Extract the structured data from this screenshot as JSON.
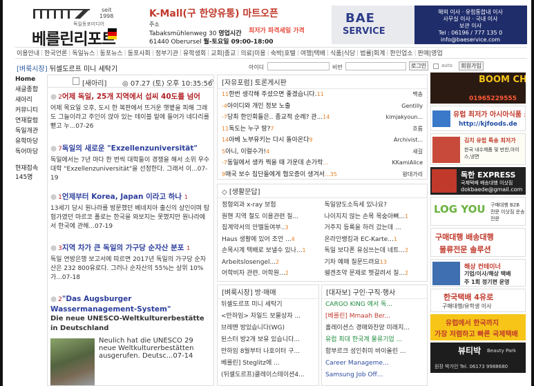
{
  "header": {
    "logo_name": "베를린리포트",
    "logo_seit": "seit",
    "logo_year": "1998",
    "logo_sub": "독일동포미디어"
  },
  "kmall": {
    "title": "K-Mall(구 한양유통) 마트오픈",
    "addr_label": "주소",
    "street": "Tabaksmühlenweg 30",
    "hours_label": "영업시간",
    "city": "61440    Oberursel",
    "hours": "월-토요일 09:00-18:00",
    "promo": "최저가 파격세일 가격"
  },
  "bae": {
    "brand1": "BAE",
    "brand2": "SERVICE",
    "line1": "해외 이사 · 유럽통합내 이사",
    "line2": "사무실 이사 · 국내 이사",
    "line3": "보관 이사",
    "line4": "Tel : 06196 / 777 135 0",
    "line5": "info@baeservice.com"
  },
  "nav": [
    "이용안내",
    "한국언론",
    "독일뉴스",
    "동포뉴스",
    "동포사회",
    "정부기관",
    "유학생회",
    "교회|종교",
    "의료|미용",
    "숙박|호텔",
    "여행|택배",
    "식품|식당",
    "법률|회계",
    "한인업소",
    "판매|영업"
  ],
  "crumb": {
    "section": "[벼룩시장]",
    "title": "뒤셀도르프 미니 세탁기"
  },
  "login": {
    "id_label": "아이디",
    "pw_label": "비번",
    "login_btn": "로그인",
    "auto_label": "auto",
    "join_btn": "회원가입"
  },
  "sidebar": {
    "items": [
      "Home",
      "새글종합",
      "새아리",
      "커뮤니티",
      "연재칼럼",
      "독일개관",
      "유학마당",
      "독어마당"
    ],
    "visit_label": "현재접속",
    "visit_count": "145명"
  },
  "news": {
    "category": "[새아리]",
    "time": "07.27 (토) 오후 10:35:56",
    "pager": "ㅇ",
    "articles": [
      {
        "num": "2",
        "title": "어제 독일, 25개 지역에서 섭씨 40도를 넘어",
        "cnt": "",
        "body": "어제 목요일 오후, 도시 한 복판에서 뜨거운 햇볕을 피해 그래도 그늘이라고 주인이 앉아 있는 테이블 밑에 들어가 네다리를 뻗고 누...07-26"
      },
      {
        "num": "7",
        "title": "독일의 새로운 \"Exzellenzuniversität\"",
        "cnt": "",
        "body": "독일에서는 7년 마다 한 번씩 대학들이 경쟁을 해서 소위 우수대학 \"Exzellenzuniversität\"을 선정한다. 그래서 이...07-19"
      },
      {
        "num": "1",
        "title": "언제부터 Korea, Japan 이라고 하나",
        "cnt": "1",
        "body": "13세기 당시 원나라를 방문했던 베네치아 출신의 상인이며 탐험가였던 마르코 폴로는 한국을 와보지는 못했지만 원나라에서 한국에 관해...07-19"
      },
      {
        "num": "3",
        "title": "지역 차가 큰 독일의 가구당 순자산 분포",
        "cnt": "1",
        "body": "독일 연방은행 보고서에 따르면 2017년 독일의 가구당 순자산은 232 800유로다. 그러나 순자산의 55%는 상위 10%가...07-18"
      },
      {
        "num": "2",
        "title": "\"Das Augsburger Wassermanagement-System\"",
        "cnt": "",
        "sub": "Die neue UNESCO-Weltkulturerbestätte in Deutschland",
        "body": "Neulich hat die UNESCO 29 neue Weltkulturerbestätten ausgerufen. Deutsc...07-14"
      }
    ]
  },
  "free_board": {
    "header": "[자유포럼] 토론게시판",
    "rows": [
      {
        "num": "11",
        "title": "한번 생각해 주셨으면 좋겠습니다.",
        "cnt": "11",
        "user": "백송"
      },
      {
        "num": "-4",
        "title": "아이디와 개인 정보 노출",
        "cnt": "",
        "user": "Gentilly"
      },
      {
        "num": "-7",
        "title": "당최 한인회들은.. 종교적 순례? 관...",
        "cnt": "14",
        "user": "kimjakyoun..."
      },
      {
        "num": "11",
        "title": "독도는 누구 땅?",
        "cnt": "7",
        "user": "흐름"
      },
      {
        "num": "14",
        "title": "아베 노부유키는 다시 돌아온다",
        "cnt": "9",
        "user": "Archivist..."
      },
      {
        "num": "5",
        "title": "아니, 이럴수가!",
        "cnt": "4",
        "user": "새길"
      },
      {
        "num": "-7",
        "title": "동일에서 생카 찍을 때 가운데 손가락",
        "cnt": "...",
        "user": "KKamiAlice"
      },
      {
        "num": "9",
        "title": "애국 보수 집단들에게 협오증이 생겨서",
        "cnt": "...35",
        "user": "왕대가리"
      }
    ]
  },
  "life_board": {
    "header": "[생활문답]",
    "left": [
      {
        "t": "정형외과 x-ray 보험",
        "c": ""
      },
      {
        "t": "원핸 지역 철도 이용관련 질...",
        "c": ""
      },
      {
        "t": "집계약서의 안멜동여부..",
        "c": "3"
      },
      {
        "t": "Haus 생활에 있어 조언 ...",
        "c": "4"
      },
      {
        "t": "손목시계 택배로 보낼수 있나...",
        "c": "1"
      },
      {
        "t": "Arbeitslosengel...",
        "c": "2"
      },
      {
        "t": "어학비자 관련. 어학원...",
        "c": "2"
      }
    ],
    "right": [
      {
        "t": "독일양도소득세 있나요?",
        "c": ""
      },
      {
        "t": "나이지지 않는 손목 목숭아뼈...",
        "c": "1"
      },
      {
        "t": "거주지 등록을 하러 갔는데 ...",
        "c": ""
      },
      {
        "t": "온라인뱅킹과 EC-Karte...",
        "c": "1"
      },
      {
        "t": "독일 보다폰 유심쓰는데 네트...",
        "c": "2"
      },
      {
        "t": "기차 예매 질문드려요",
        "c": "13"
      },
      {
        "t": "쉥겐조약 문제로 헷갈려서 질...",
        "c": "2"
      }
    ]
  },
  "trade_board": {
    "header": "[벼룩시장] 방·매매",
    "items": [
      {
        "t": "뒤셀도르프 미니 세탁기",
        "c": ""
      },
      {
        "t": "<만하임> 자일드 보물상자 ...",
        "c": ""
      },
      {
        "t": "브레멘 방있습니다(WG)",
        "c": ""
      },
      {
        "t": "뒨스터 방2개 보유 있습니다...",
        "c": ""
      },
      {
        "t": "만하임 8월부터 나호이터 구...",
        "c": ""
      },
      {
        "t": "베를린] Steglitz에 ...",
        "c": ""
      },
      {
        "t": "(뒤셀도르프)클레이스테이션4...",
        "c": ""
      }
    ]
  },
  "jobs_board": {
    "header": "[대자보] 구인·구직·행사",
    "items": [
      {
        "t": "CARGO KING 에서 독...",
        "style": "green"
      },
      {
        "t": "[베를린] Mmaah Ber...",
        "style": "red"
      },
      {
        "t": "홀레이션스 경매와찬양 미래지...",
        "style": ""
      },
      {
        "t": "유럽 최대 한국계 물류기업 ...",
        "style": "green"
      },
      {
        "t": "함부르크 성인취미 바이올린 ...",
        "style": ""
      },
      {
        "t": "Career Manageme...",
        "style": "blue"
      },
      {
        "t": "Samsung Job Off...",
        "style": "blue"
      }
    ]
  },
  "ads": [
    {
      "l1": "BOOM CHICKEN",
      "l2": "01965229555"
    },
    {
      "l1": "유럽 최저가 아시아식품 쇼핑몰",
      "l2": "http://kjfoods.de"
    },
    {
      "l1": "김치 유럽 특송 최저가",
      "l2": "한국 내수제품 및 반찬,아이스,냉면"
    },
    {
      "l1": "독한 EXPRESS",
      "l2": "국제택배 배송대행 이삿짐",
      "l3": "dokbaede@gmail.com"
    },
    {
      "l1": "LOG YOU",
      "l2": "구매대행 B2B 전문 이삿짐 운송 전문"
    },
    {
      "l1": "구매대행 배송대행",
      "l2": "물류전문 솔루션"
    },
    {
      "l1": "해상 컨테이너",
      "l2": "기업/이사/해상 택배",
      "l3": "주 1회 정기편 운영"
    },
    {
      "l1": "한국택배 4유로",
      "l2": "구매대행/유학생 이사"
    },
    {
      "l1": "유럽에서 한국까지",
      "l2": "가장 저렴하고 빠른 국제택배"
    },
    {
      "l1": "뷰티박",
      "l2": "Beauty Park",
      "l3": "원장 박가인  Tel. 06173 9988680"
    }
  ]
}
